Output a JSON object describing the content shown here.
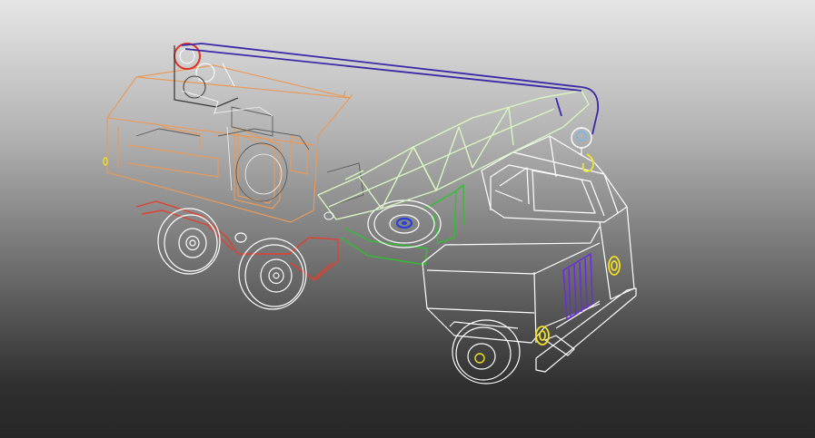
{
  "scene": {
    "subject": "crane-truck-wireframe",
    "colors": {
      "body": "#ffffff",
      "crane_cabin": "#e89a5a",
      "boom": "#d8f5c0",
      "cable": "#3a2aa8",
      "spare_wheel_hub": "#2840d8",
      "frame": "#30c030",
      "fender": "#e04030",
      "lights": "#f0e020",
      "grille": "#6a30d8",
      "winch": "#e03020",
      "hook": "#e8e040"
    }
  }
}
